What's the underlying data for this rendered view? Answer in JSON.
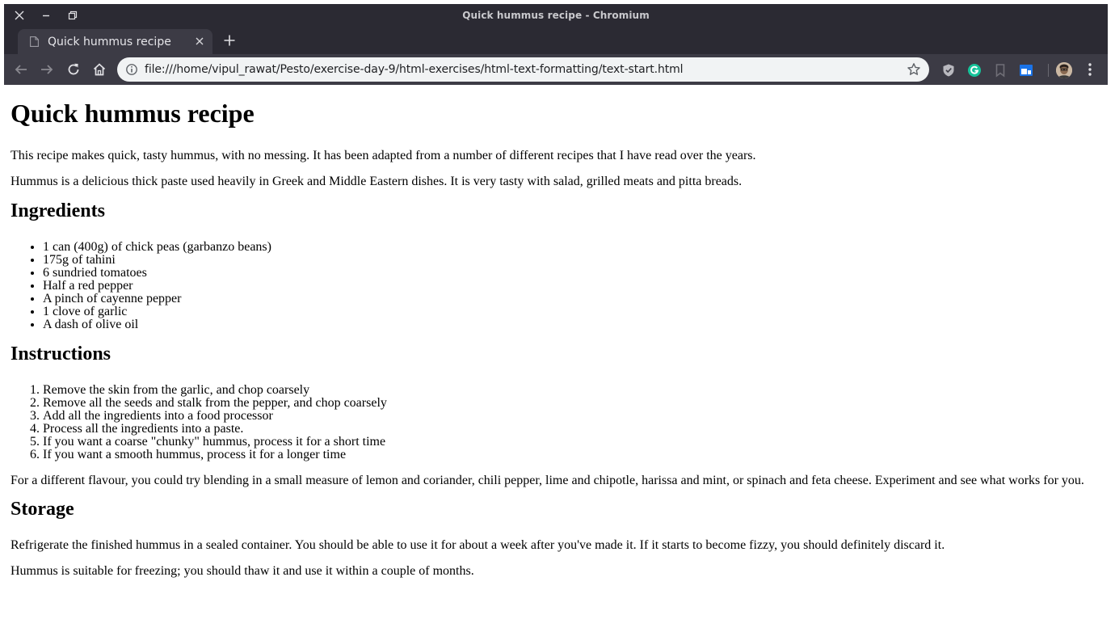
{
  "browser": {
    "window_title": "Quick hummus recipe - Chromium",
    "tab": {
      "title": "Quick hummus recipe"
    },
    "address_bar": {
      "url": "file:///home/vipul_rawat/Pesto/exercise-day-9/html-exercises/html-text-formatting/text-start.html"
    },
    "extensions": [
      "shield-extension-icon",
      "grammarly-icon",
      "bookmark-extension-icon",
      "window-extension-icon"
    ]
  },
  "colors": {
    "titlebar_bg": "#2b2a33",
    "toolbar_bg": "#3c3b45",
    "omnibox_bg": "#f1f3f4",
    "grammarly_green": "#15c39a",
    "extension_blue": "#1a73e8"
  },
  "page": {
    "title": "Quick hummus recipe",
    "intro": [
      "This recipe makes quick, tasty hummus, with no messing. It has been adapted from a number of different recipes that I have read over the years.",
      "Hummus is a delicious thick paste used heavily in Greek and Middle Eastern dishes. It is very tasty with salad, grilled meats and pitta breads."
    ],
    "ingredients_heading": "Ingredients",
    "ingredients": [
      "1 can (400g) of chick peas (garbanzo beans)",
      "175g of tahini",
      "6 sundried tomatoes",
      "Half a red pepper",
      "A pinch of cayenne pepper",
      "1 clove of garlic",
      "A dash of olive oil"
    ],
    "instructions_heading": "Instructions",
    "instructions": [
      "Remove the skin from the garlic, and chop coarsely",
      "Remove all the seeds and stalk from the pepper, and chop coarsely",
      "Add all the ingredients into a food processor",
      "Process all the ingredients into a paste.",
      "If you want a coarse \"chunky\" hummus, process it for a short time",
      "If you want a smooth hummus, process it for a longer time"
    ],
    "variation": "For a different flavour, you could try blending in a small measure of lemon and coriander, chili pepper, lime and chipotle, harissa and mint, or spinach and feta cheese. Experiment and see what works for you.",
    "storage_heading": "Storage",
    "storage": [
      "Refrigerate the finished hummus in a sealed container. You should be able to use it for about a week after you've made it. If it starts to become fizzy, you should definitely discard it.",
      "Hummus is suitable for freezing; you should thaw it and use it within a couple of months."
    ]
  }
}
